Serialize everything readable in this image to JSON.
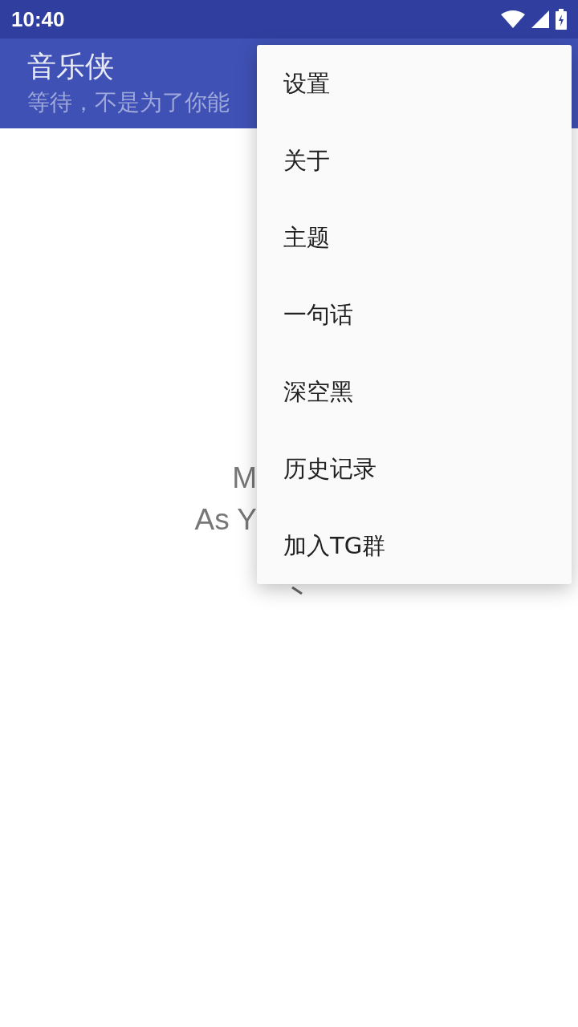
{
  "status_bar": {
    "time": "10:40"
  },
  "app_bar": {
    "title": "音乐侠",
    "subtitle": "等待，不是为了你能"
  },
  "content": {
    "lines": [
      "M",
      "As Y"
    ]
  },
  "menu": {
    "items": [
      {
        "label": "设置"
      },
      {
        "label": "关于"
      },
      {
        "label": "主题"
      },
      {
        "label": "一句话"
      },
      {
        "label": "深空黑"
      },
      {
        "label": "历史记录"
      },
      {
        "label": "加入TG群"
      }
    ]
  }
}
